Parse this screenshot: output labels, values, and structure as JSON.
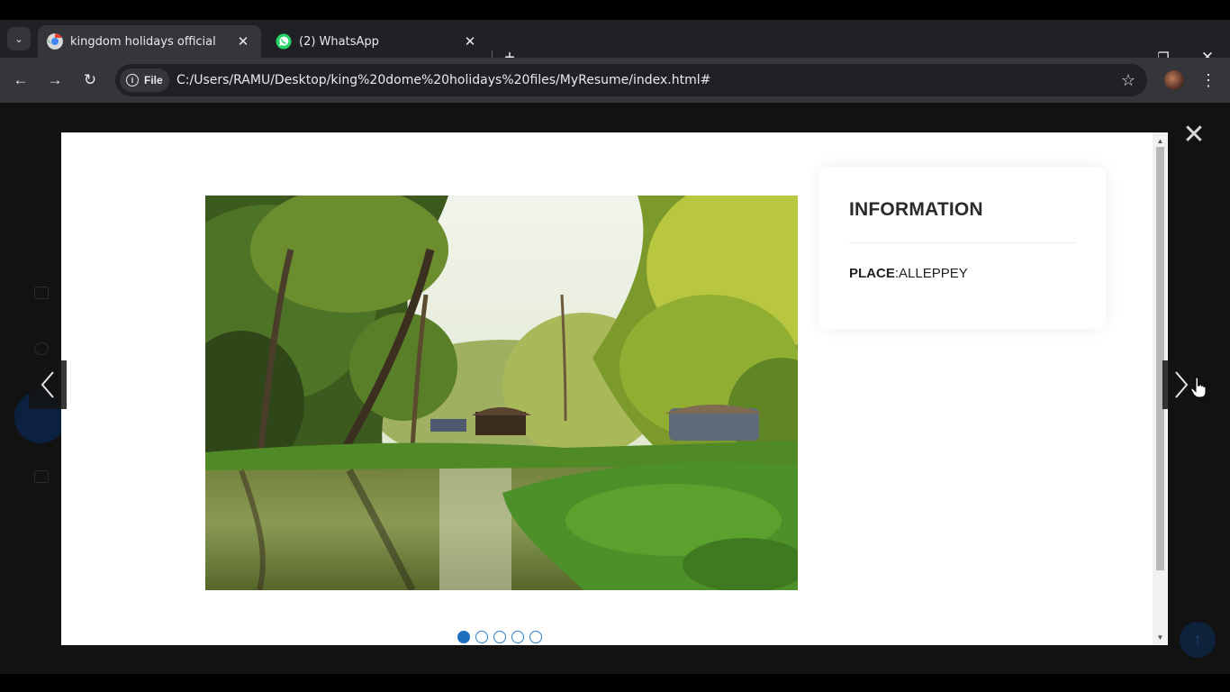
{
  "browser": {
    "tabs": [
      {
        "title": "kingdom holidays official",
        "active": true,
        "icon": "chrome-favicon"
      },
      {
        "title": "(2) WhatsApp",
        "active": false,
        "icon": "whatsapp-icon"
      }
    ],
    "address": {
      "chip_label": "File",
      "url": "C:/Users/RAMU/Desktop/king%20dome%20holidays%20files/MyResume/index.html#"
    },
    "icons": {
      "tab_search": "chevron-down-icon",
      "new_tab": "plus-icon",
      "back": "back-arrow-icon",
      "forward": "forward-arrow-icon",
      "reload": "reload-icon",
      "bookmark": "star-icon",
      "menu": "kebab-menu-icon"
    }
  },
  "glyphs": {
    "tab_search": "⌄",
    "close": "✕",
    "plus": "+",
    "minimize": "—",
    "restore": "❐",
    "back": "←",
    "forward": "→",
    "reload": "↻",
    "info": "i",
    "star": "☆",
    "kebab": "⋮",
    "lightbox_close": "✕",
    "scroll_up": "▲",
    "scroll_down": "▼",
    "up": "↑"
  },
  "lightbox": {
    "image_alt": "Alleppey backwaters with houseboats and coconut palms",
    "info_title": "INFORMATION",
    "place_label": "PLACE",
    "place_value": ":ALLEPPEY",
    "slide_count": 5,
    "active_slide": 1
  },
  "colors": {
    "chrome_dark": "#202124",
    "chrome_mid": "#35363a",
    "accent_blue": "#1f6fbf"
  }
}
